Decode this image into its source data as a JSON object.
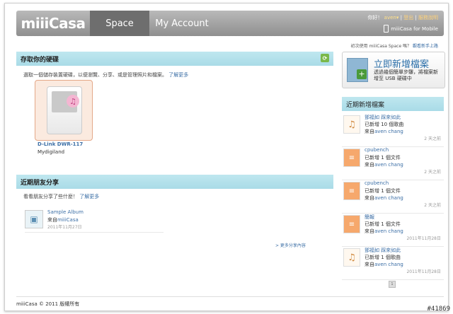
{
  "header": {
    "logo": "miiiCasa",
    "tabs": [
      {
        "label": "Space"
      },
      {
        "label": "My Account"
      }
    ],
    "greeting": "你好！",
    "user": "aven",
    "logout": "登出",
    "service": "服務說明",
    "mobile": "miiiCasa for Mobile"
  },
  "hint": {
    "text": "初次使用 miiiCasa Space 嗎？",
    "link": "觀看新手上路"
  },
  "storage": {
    "title": "存取你的硬碟",
    "intro": "選取一個儲存裝置硬碟，以便瀏覽、分享、或是管理照片和檔案。",
    "more": "了解更多",
    "device_name": "D-Link DWR-117",
    "device_sub": "Mydigiland"
  },
  "shares": {
    "title": "近期朋友分享",
    "intro": "看看朋友分享了些什麼！",
    "more": "了解更多",
    "items": [
      {
        "title": "Sample Album",
        "from_prefix": "來自",
        "from": "miiiCasa",
        "date": "2011年11月27日"
      }
    ],
    "more_link": "> 更多分享內容"
  },
  "add_file": {
    "title": "立即新增檔案",
    "desc": "透過幾個簡單步驟，將檔案新增至 USB 硬碟中"
  },
  "recent": {
    "title": "近期新增檔案",
    "items": [
      {
        "icon": "music",
        "title": "鄧福如 踩來如此",
        "desc": "已新增 10 個歌曲",
        "from_prefix": "來自",
        "from": "aven chang",
        "time": "2 天之前"
      },
      {
        "icon": "doc",
        "title": "cpubench",
        "desc": "已新增 1 個文件",
        "from_prefix": "來自",
        "from": "aven chang",
        "time": "2 天之前"
      },
      {
        "icon": "doc",
        "title": "cpubench",
        "desc": "已新增 1 個文件",
        "from_prefix": "來自",
        "from": "aven chang",
        "time": "2 天之前"
      },
      {
        "icon": "doc",
        "title": "簡報",
        "desc": "已新增 1 個文件",
        "from_prefix": "來自",
        "from": "aven chang",
        "time": "2011年11月28日"
      },
      {
        "icon": "music",
        "title": "鄧福如 踩來如此",
        "desc": "已新增 1 個歌曲",
        "from_prefix": "來自",
        "from": "aven chang",
        "time": "2011年11月28日"
      }
    ],
    "page": "1"
  },
  "footer": "miiiCasa © 2011   版權所有",
  "watermark": "#41869"
}
